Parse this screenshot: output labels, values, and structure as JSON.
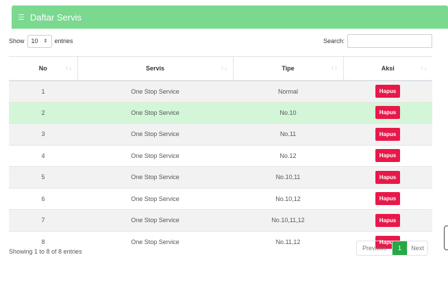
{
  "header": {
    "title": "Daftar Servis",
    "menu_icon": "hamburger-icon"
  },
  "controls": {
    "show_label": "Show",
    "entries_value": "10",
    "entries_label": "entries",
    "search_label": "Search:",
    "search_value": ""
  },
  "table": {
    "columns": [
      "No",
      "Servis",
      "Tipe",
      "Aksi"
    ],
    "rows": [
      {
        "no": "1",
        "servis": "One Stop Service",
        "tipe": "Normal",
        "aksi": "Hapus"
      },
      {
        "no": "2",
        "servis": "One Stop Service",
        "tipe": "No.10",
        "aksi": "Hapus"
      },
      {
        "no": "3",
        "servis": "One Stop Service",
        "tipe": "No.11",
        "aksi": "Hapus"
      },
      {
        "no": "4",
        "servis": "One Stop Service",
        "tipe": "No.12",
        "aksi": "Hapus"
      },
      {
        "no": "5",
        "servis": "One Stop Service",
        "tipe": "No.10,11",
        "aksi": "Hapus"
      },
      {
        "no": "6",
        "servis": "One Stop Service",
        "tipe": "No.10,12",
        "aksi": "Hapus"
      },
      {
        "no": "7",
        "servis": "One Stop Service",
        "tipe": "No.10,11,12",
        "aksi": "Hapus"
      },
      {
        "no": "8",
        "servis": "One Stop Service",
        "tipe": "No.11,12",
        "aksi": "Hapus"
      }
    ],
    "highlighted_row": 2
  },
  "footer": {
    "info": "Showing 1 to 8 of 8 entries",
    "prev": "Previous",
    "current_page": "1",
    "next": "Next"
  },
  "colors": {
    "header_bg": "#7bd88f",
    "hapus_bg": "#e8194a",
    "page_active": "#28a745",
    "row_highlight": "#d3f5d8"
  }
}
